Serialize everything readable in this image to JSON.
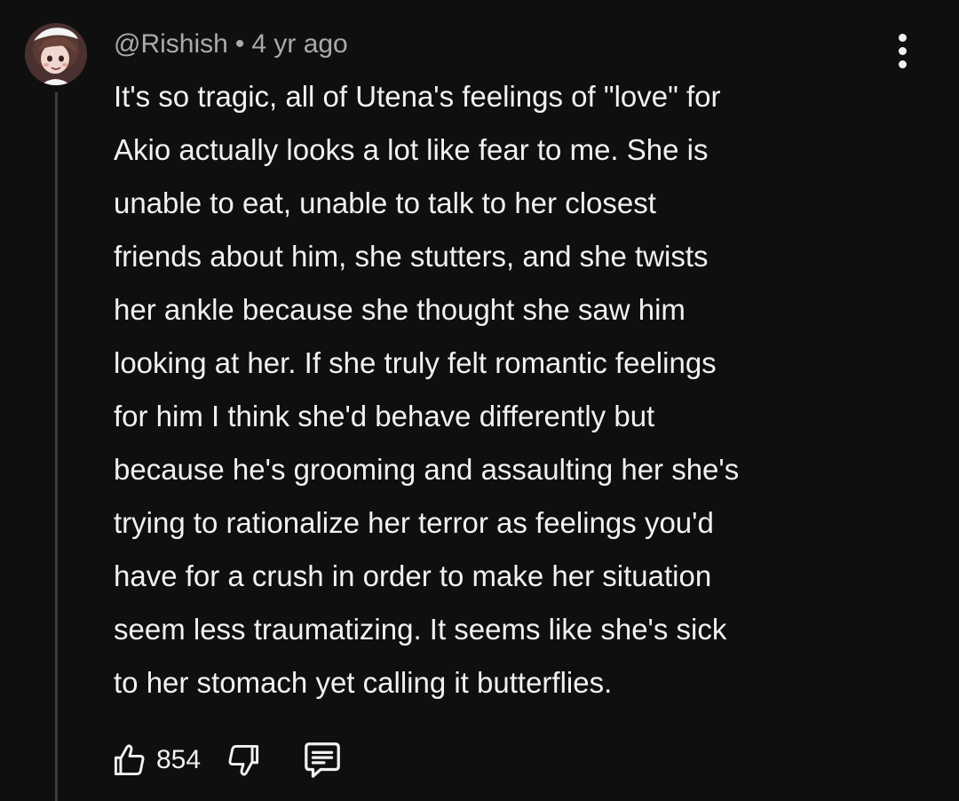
{
  "comment": {
    "author": "@Rishish",
    "separator": "•",
    "time": "4 yr ago",
    "lines": [
      "It's so tragic, all of Utena's feelings of \"love\" for",
      "Akio actually looks a lot like fear to me. She is",
      "unable to eat, unable to talk to her closest",
      "friends about him, she stutters, and she twists",
      "her ankle because she thought she saw him",
      "looking at her. If she truly felt romantic feelings",
      "for him I think she'd behave differently but",
      "because he's grooming and assaulting her she's",
      "trying to rationalize her terror as feelings you'd",
      "have for a crush in order to make her situation",
      "seem less traumatizing. It seems like she's sick",
      "to her stomach yet calling it butterflies."
    ],
    "like_count": "854"
  },
  "icons": {
    "more": "more-vertical-icon",
    "like": "thumbs-up-icon",
    "dislike": "thumbs-down-icon",
    "reply": "reply-comment-icon"
  },
  "colors": {
    "background": "#0f0f0f",
    "text_primary": "#f1f1f1",
    "text_secondary": "#aaaaaa",
    "thread_line": "#3d3d3d"
  }
}
